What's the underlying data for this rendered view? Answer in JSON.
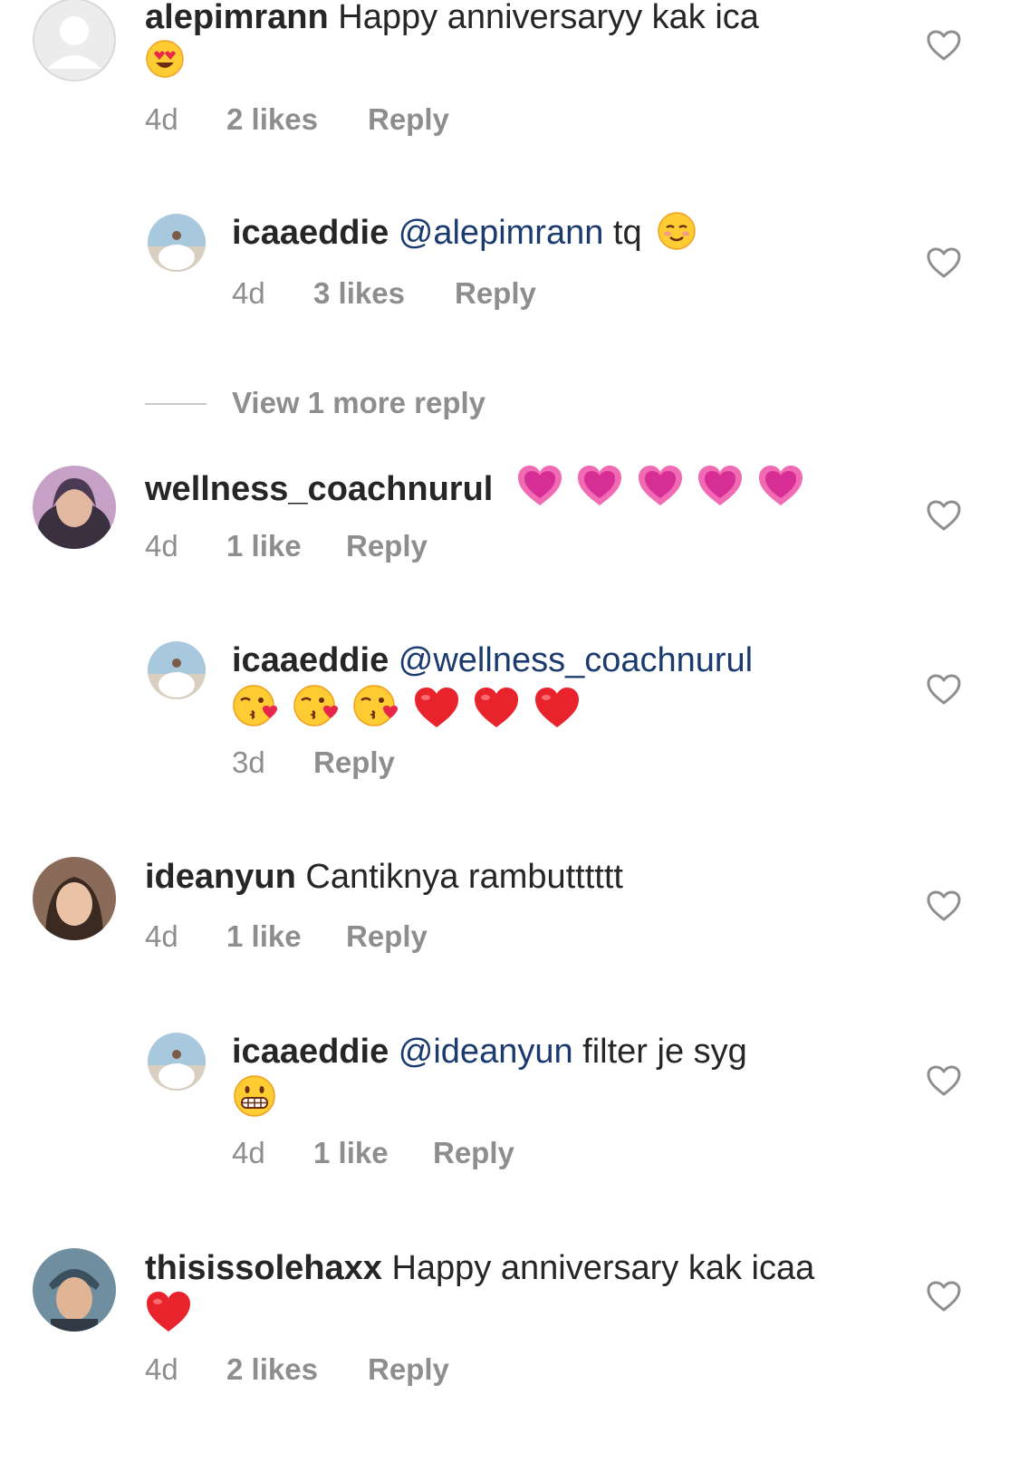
{
  "comments": [
    {
      "username": "alepimrann",
      "text": "Happy anniversaryy kak ica",
      "emojis": [
        "heart-eyes"
      ],
      "time": "4d",
      "likes": "2 likes",
      "reply": "Reply"
    },
    {
      "username": "icaaeddie",
      "mention": "@alepimrann",
      "text": "tq",
      "emojis": [
        "smiling-blush"
      ],
      "time": "4d",
      "likes": "3 likes",
      "reply": "Reply"
    },
    {
      "username": "wellness_coachnurul",
      "text": "",
      "emojis": [
        "growing-heart",
        "growing-heart",
        "growing-heart",
        "growing-heart",
        "growing-heart"
      ],
      "time": "4d",
      "likes": "1 like",
      "reply": "Reply"
    },
    {
      "username": "icaaeddie",
      "mention": "@wellness_coachnurul",
      "text": "",
      "emojis": [
        "kissing-heart",
        "kissing-heart",
        "kissing-heart",
        "red-heart",
        "red-heart",
        "red-heart"
      ],
      "time": "3d",
      "likes": "",
      "reply": "Reply"
    },
    {
      "username": "ideanyun",
      "text": "Cantiknya rambutttttt",
      "emojis": [],
      "time": "4d",
      "likes": "1 like",
      "reply": "Reply"
    },
    {
      "username": "icaaeddie",
      "mention": "@ideanyun",
      "text": "filter je syg",
      "emojis": [
        "grimacing"
      ],
      "time": "4d",
      "likes": "1 like",
      "reply": "Reply"
    },
    {
      "username": "thisissolehaxx",
      "text": "Happy anniversary kak icaa",
      "emojis": [
        "red-heart"
      ],
      "time": "4d",
      "likes": "2 likes",
      "reply": "Reply"
    }
  ],
  "view_more": "View 1 more reply",
  "icons": {
    "like": "heart-outline-icon"
  },
  "colors": {
    "text": "#262626",
    "meta": "#8e8e8e",
    "mention": "#1b3b6f"
  }
}
